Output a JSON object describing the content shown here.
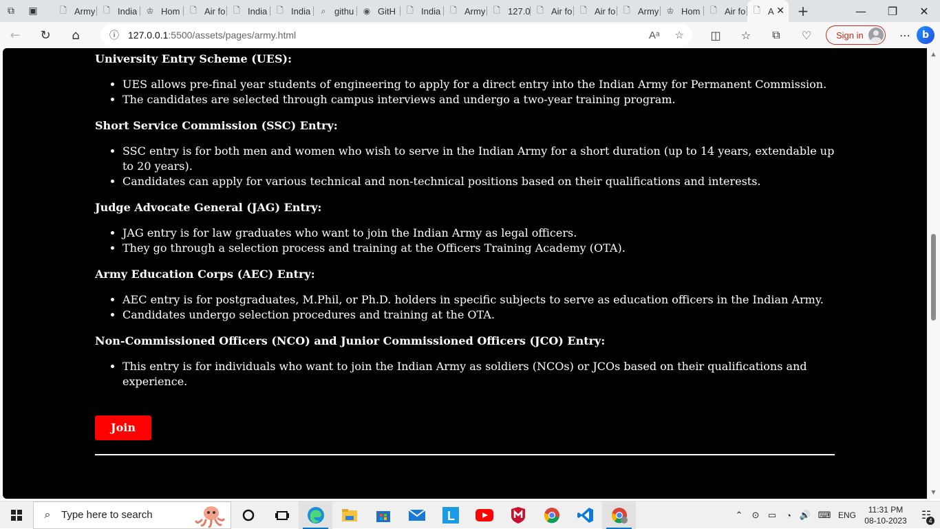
{
  "browser": {
    "tabs": [
      {
        "label": "Army",
        "icon": "page-icon"
      },
      {
        "label": "India",
        "icon": "page-icon"
      },
      {
        "label": "Hom",
        "icon": "emblem-icon"
      },
      {
        "label": "Air fo",
        "icon": "page-icon"
      },
      {
        "label": "India",
        "icon": "page-icon"
      },
      {
        "label": "India",
        "icon": "page-icon"
      },
      {
        "label": "githu",
        "icon": "search-icon"
      },
      {
        "label": "GitH",
        "icon": "github-icon"
      },
      {
        "label": "India",
        "icon": "page-icon"
      },
      {
        "label": "Army",
        "icon": "page-icon"
      },
      {
        "label": "127.0",
        "icon": "page-icon"
      },
      {
        "label": "Air fo",
        "icon": "page-icon"
      },
      {
        "label": "Air fo",
        "icon": "page-icon"
      },
      {
        "label": "Army",
        "icon": "page-icon"
      },
      {
        "label": "Hom",
        "icon": "emblem-icon"
      },
      {
        "label": "Air fo",
        "icon": "page-icon"
      },
      {
        "label": "A",
        "icon": "page-icon"
      }
    ],
    "address": {
      "host": "127.0.0.1",
      "path": ":5500/assets/pages/army.html"
    },
    "signin_label": "Sign in"
  },
  "page": {
    "sections": [
      {
        "title": "University Entry Scheme (UES):",
        "items": [
          "UES allows pre-final year students of engineering to apply for a direct entry into the Indian Army for Permanent Commission.",
          "The candidates are selected through campus interviews and undergo a two-year training program."
        ]
      },
      {
        "title": "Short Service Commission (SSC) Entry:",
        "items": [
          "SSC entry is for both men and women who wish to serve in the Indian Army for a short duration (up to 14 years, extendable up to 20 years).",
          "Candidates can apply for various technical and non-technical positions based on their qualifications and interests."
        ]
      },
      {
        "title": "Judge Advocate General (JAG) Entry:",
        "items": [
          "JAG entry is for law graduates who want to join the Indian Army as legal officers.",
          "They go through a selection process and training at the Officers Training Academy (OTA)."
        ]
      },
      {
        "title": "Army Education Corps (AEC) Entry:",
        "items": [
          "AEC entry is for postgraduates, M.Phil, or Ph.D. holders in specific subjects to serve as education officers in the Indian Army.",
          "Candidates undergo selection procedures and training at the OTA."
        ]
      },
      {
        "title": "Non-Commissioned Officers (NCO) and Junior Commissioned Officers (JCO) Entry:",
        "items": [
          "This entry is for individuals who want to join the Indian Army as soldiers (NCOs) or JCOs based on their qualifications and experience."
        ]
      }
    ],
    "join_label": "Join",
    "join_color": "#ff0000",
    "background": "#000000"
  },
  "taskbar": {
    "search_placeholder": "Type here to search",
    "apps": [
      "cortana-icon",
      "task-view-icon",
      "edge-icon",
      "file-explorer-icon",
      "store-icon",
      "mail-icon",
      "l-app-icon",
      "youtube-icon",
      "mcafee-icon",
      "chrome-icon",
      "vscode-icon",
      "chrome-dev-icon"
    ],
    "language": "ENG",
    "time": "11:31 PM",
    "date": "08-10-2023",
    "notification_count": "4"
  }
}
